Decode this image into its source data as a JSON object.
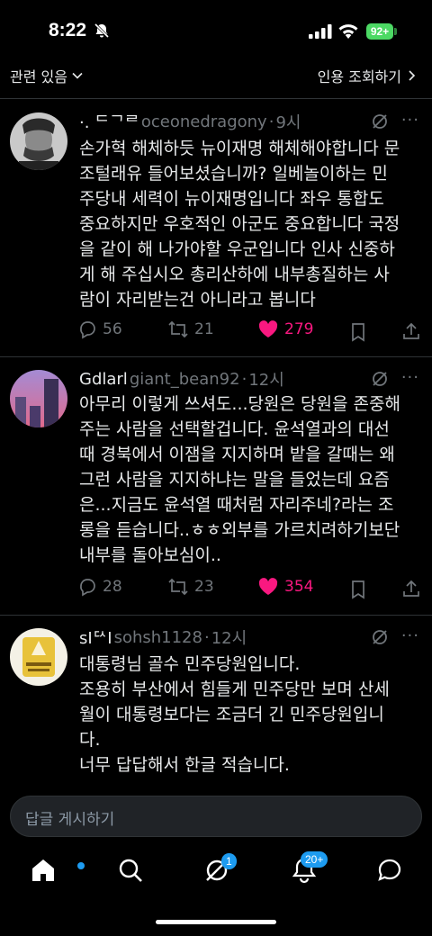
{
  "status": {
    "time": "8:22",
    "battery": "92+"
  },
  "subheader": {
    "related": "관련 있음",
    "quotes": "인용 조회하기"
  },
  "tweets": [
    {
      "name": "·. ᄃᄀᄅ",
      "handle": "oceonedragony",
      "time": "9시",
      "lines": [
        "손가혁 해체하듯 뉴이재명 해체해야합니다 문",
        "조털래유 들어보셨습니까? 일베놀이하는 민",
        "주당내 세력이 뉴이재명입니다 좌우 통합도",
        "중요하지만 우호적인 아군도 중요합니다 국정",
        "을 같이 해 나가야할 우군입니다 인사 신중하",
        "게 해 주십시오 총리산하에 내부총질하는 사",
        "람이 자리받는건 아니라고 봅니다"
      ],
      "replies": "56",
      "retweets": "21",
      "likes": "279"
    },
    {
      "name": "Gdlarl",
      "handle": "giant_bean92",
      "time": "12시",
      "lines": [
        "아무리 이렇게 쓰셔도...당원은 당원을 존중해",
        "주는 사람을 선택할겁니다. 윤석열과의 대선",
        "때 경북에서 이잼을 지지하며 밭을 갈때는 왜",
        "그런 사람을 지지하냐는 말을 들었는데 요즘",
        "은...지금도 윤석열 때처럼 자리주네?라는 조",
        "롱을 듣습니다..ㅎㅎ외부를 가르치려하기보단",
        "내부를 돌아보심이.."
      ],
      "replies": "28",
      "retweets": "23",
      "likes": "354"
    },
    {
      "name": "sIᄃᄉI",
      "handle": "sohsh1128",
      "time": "12시",
      "lines": [
        "대통령님 골수 민주당원입니다.",
        "조용히 부산에서 힘들게 민주당만 보며 산세",
        "월이 대통령보다는 조금더 긴 민주당원입니",
        "다.",
        "너무 답답해서 한글 적습니다."
      ]
    }
  ],
  "reply_placeholder": "답글 게시하기",
  "tabbar": {
    "notifications_badge": "20+",
    "spaces_badge": "1"
  },
  "colors": {
    "accent": "#1d9bf0",
    "like": "#f91880",
    "muted": "#71767b",
    "battery": "#4cd964"
  }
}
